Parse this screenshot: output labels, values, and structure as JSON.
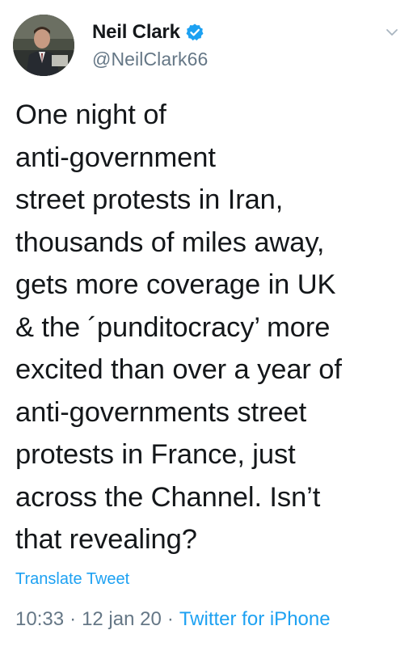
{
  "author": {
    "display_name": "Neil Clark",
    "handle": "@NeilClark66",
    "verified": true
  },
  "tweet": {
    "text_lines": [
      "One night of",
      "anti-government",
      "street protests in Iran,",
      "thousands of miles away,",
      "gets more coverage in UK",
      "& the ´punditocracy’ more",
      "excited than over a year of",
      "anti-governments street",
      "protests in France, just",
      "across the Channel. Isn’t",
      "that revealing?"
    ],
    "translate_label": "Translate Tweet"
  },
  "meta": {
    "time": "10:33",
    "separator": "·",
    "date": "12 jan 20",
    "source": "Twitter for iPhone"
  },
  "icons": {
    "verified": "verified-badge-icon",
    "menu": "chevron-down-icon"
  },
  "colors": {
    "accent": "#1da1f2",
    "text": "#14171a",
    "secondary_text": "#657786",
    "background": "#ffffff"
  }
}
